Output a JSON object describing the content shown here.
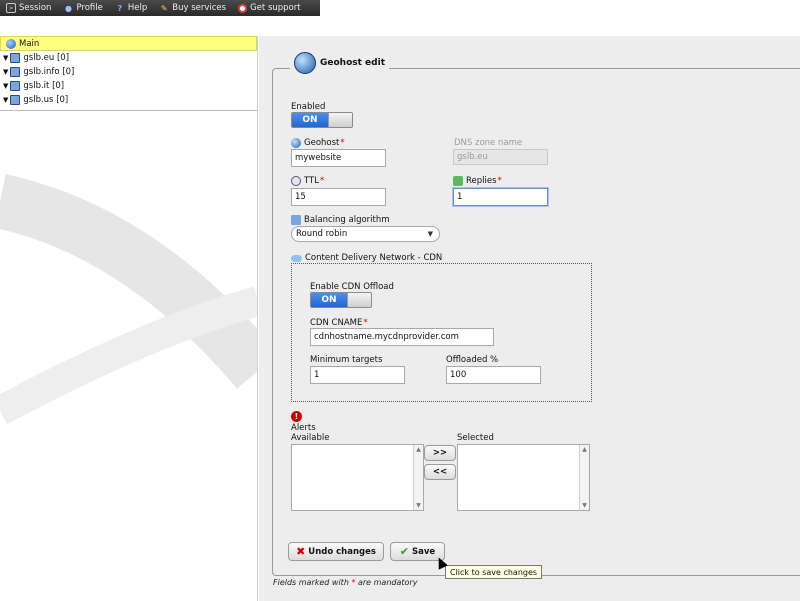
{
  "topbar": {
    "items": [
      {
        "label": "Session",
        "icon": "terminal-icon"
      },
      {
        "label": "Profile",
        "icon": "user-icon"
      },
      {
        "label": "Help",
        "icon": "help-icon"
      },
      {
        "label": "Buy services",
        "icon": "cart-icon"
      },
      {
        "label": "Get support",
        "icon": "lifebuoy-icon"
      }
    ]
  },
  "tree": {
    "root": "Main",
    "items": [
      {
        "label": "gslb.eu [0]"
      },
      {
        "label": "gslb.info [0]"
      },
      {
        "label": "gslb.it [0]"
      },
      {
        "label": "gslb.us [0]"
      }
    ]
  },
  "form": {
    "title": "Geohost edit",
    "enabled_label": "Enabled",
    "enabled_toggle": "ON",
    "geohost_label": "Geohost",
    "geohost_value": "mywebsite",
    "dns_zone_label": "DNS zone name",
    "dns_zone_value": "gslb.eu",
    "ttl_label": "TTL",
    "ttl_value": "15",
    "replies_label": "Replies",
    "replies_value": "1",
    "balancing_label": "Balancing algorithm",
    "balancing_value": "Round robin",
    "required_mark": "*"
  },
  "cdn": {
    "title": "Content Delivery Network - CDN",
    "offload_label": "Enable CDN Offload",
    "offload_toggle": "ON",
    "cname_label": "CDN CNAME",
    "cname_value": "cdnhostname.mycdnprovider.com",
    "min_targets_label": "Minimum targets",
    "min_targets_value": "1",
    "offloaded_label": "Offloaded %",
    "offloaded_value": "100"
  },
  "alerts": {
    "title": "Alerts",
    "available_label": "Available",
    "selected_label": "Selected",
    "add_label": ">>",
    "remove_label": "<<"
  },
  "actions": {
    "undo_label": "Undo changes",
    "save_label": "Save",
    "tooltip": "Click to save changes"
  },
  "footnote": {
    "before": "Fields marked with ",
    "mark": "*",
    "after": " are mandatory"
  },
  "colors": {
    "toggle_on": "#2f74e0",
    "required": "#d00000",
    "tree_root_bg": "#ffff80"
  }
}
